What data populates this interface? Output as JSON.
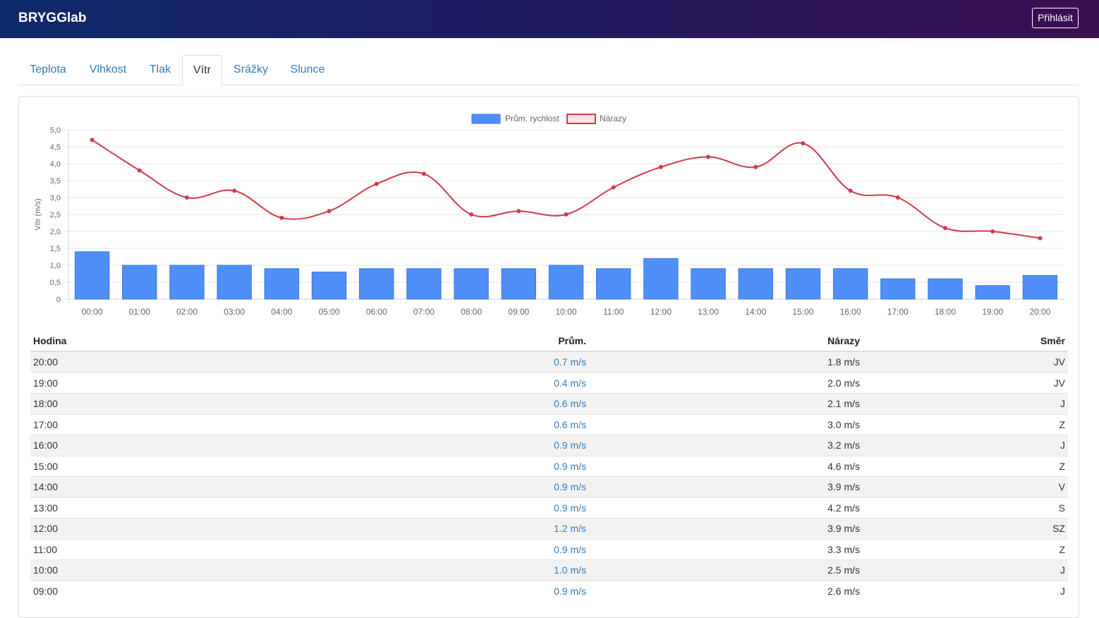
{
  "app": {
    "brand": "BRYGGlab",
    "login_label": "Přihlásit"
  },
  "tabs": [
    {
      "label": "Teplota",
      "active": false
    },
    {
      "label": "Vlhkost",
      "active": false
    },
    {
      "label": "Tlak",
      "active": false
    },
    {
      "label": "Vítr",
      "active": true
    },
    {
      "label": "Srážky",
      "active": false
    },
    {
      "label": "Slunce",
      "active": false
    }
  ],
  "chart_data": {
    "type": "bar",
    "ylabel": "Vítr (m/s)",
    "ylim": [
      0,
      5
    ],
    "yticks": [
      "0",
      "0,5",
      "1,0",
      "1,5",
      "2,0",
      "2,5",
      "3,0",
      "3,5",
      "4,0",
      "4,5",
      "5,0"
    ],
    "categories": [
      "00:00",
      "01:00",
      "02:00",
      "03:00",
      "04:00",
      "05:00",
      "06:00",
      "07:00",
      "08:00",
      "09:00",
      "10:00",
      "11:00",
      "12:00",
      "13:00",
      "14:00",
      "15:00",
      "16:00",
      "17:00",
      "18:00",
      "19:00",
      "20:00"
    ],
    "series": [
      {
        "name": "Prům. rychlost",
        "type": "bar",
        "color": "#4f8ff7",
        "values": [
          1.4,
          1.0,
          1.0,
          1.0,
          0.9,
          0.8,
          0.9,
          0.9,
          0.9,
          0.9,
          1.0,
          0.9,
          1.2,
          0.9,
          0.9,
          0.9,
          0.9,
          0.6,
          0.6,
          0.4,
          0.7
        ]
      },
      {
        "name": "Nárazy",
        "type": "line",
        "color": "#d03a4a",
        "values": [
          4.7,
          3.8,
          3.0,
          3.2,
          2.4,
          2.6,
          3.4,
          3.7,
          2.5,
          2.6,
          2.5,
          3.3,
          3.9,
          4.2,
          3.9,
          4.6,
          3.2,
          3.0,
          2.1,
          2.0,
          1.8
        ]
      }
    ],
    "legend": "top-center",
    "grid": true
  },
  "table": {
    "headers": {
      "hour": "Hodina",
      "avg": "Prům.",
      "gust": "Nárazy",
      "dir": "Směr"
    },
    "rows": [
      {
        "hour": "20:00",
        "avg": "0.7 m/s",
        "gust": "1.8 m/s",
        "dir": "JV"
      },
      {
        "hour": "19:00",
        "avg": "0.4 m/s",
        "gust": "2.0 m/s",
        "dir": "JV"
      },
      {
        "hour": "18:00",
        "avg": "0.6 m/s",
        "gust": "2.1 m/s",
        "dir": "J"
      },
      {
        "hour": "17:00",
        "avg": "0.6 m/s",
        "gust": "3.0 m/s",
        "dir": "Z"
      },
      {
        "hour": "16:00",
        "avg": "0.9 m/s",
        "gust": "3.2 m/s",
        "dir": "J"
      },
      {
        "hour": "15:00",
        "avg": "0.9 m/s",
        "gust": "4.6 m/s",
        "dir": "Z"
      },
      {
        "hour": "14:00",
        "avg": "0.9 m/s",
        "gust": "3.9 m/s",
        "dir": "V"
      },
      {
        "hour": "13:00",
        "avg": "0.9 m/s",
        "gust": "4.2 m/s",
        "dir": "S"
      },
      {
        "hour": "12:00",
        "avg": "1.2 m/s",
        "gust": "3.9 m/s",
        "dir": "SZ"
      },
      {
        "hour": "11:00",
        "avg": "0.9 m/s",
        "gust": "3.3 m/s",
        "dir": "Z"
      },
      {
        "hour": "10:00",
        "avg": "1.0 m/s",
        "gust": "2.5 m/s",
        "dir": "J"
      },
      {
        "hour": "09:00",
        "avg": "0.9 m/s",
        "gust": "2.6 m/s",
        "dir": "J"
      }
    ]
  }
}
